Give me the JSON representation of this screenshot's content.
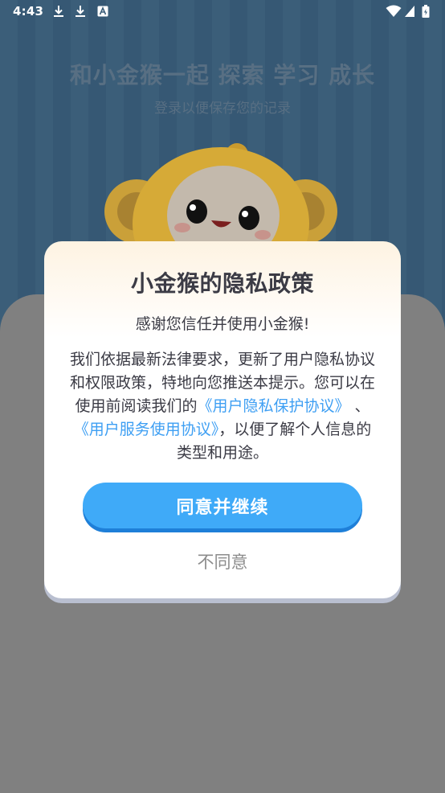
{
  "status_bar": {
    "time": "4:43",
    "left_icons": [
      "download-icon",
      "download-icon",
      "font-a-icon"
    ],
    "right_icons": [
      "wifi-icon",
      "cell-signal-icon",
      "battery-icon"
    ]
  },
  "background": {
    "headline": "和小金猴一起 探索 学习 成长",
    "subtitle": "登录以便保存您的记录"
  },
  "dialog": {
    "title": "小金猴的隐私政策",
    "greeting": "感谢您信任并使用小金猴!",
    "body_text_1": "我们依据最新法律要求，更新了用户隐私协议和权限政策，特地向您推送本提示。您可以在使用前阅读我们的",
    "privacy_link": "《用户隐私保护协议》",
    "separator": "、",
    "service_link": "《用户服务使用协议》",
    "body_text_2": "，以便了解个人信息的类型和用途。",
    "agree_label": "同意并继续",
    "disagree_label": "不同意"
  },
  "colors": {
    "link": "#3e9ff3",
    "primary_button": "#3faaf8",
    "title_text": "#3b3b45"
  }
}
